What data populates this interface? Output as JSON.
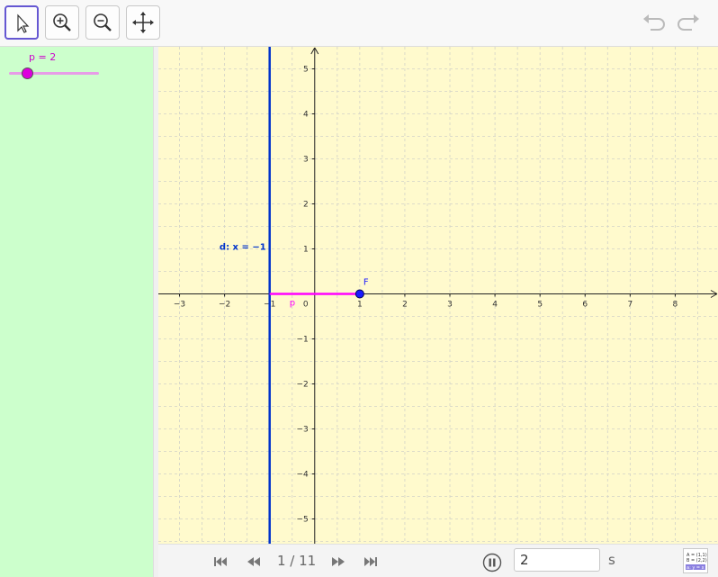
{
  "toolbar": {
    "tools": [
      {
        "icon": "arrow-pointer-icon",
        "selected": true
      },
      {
        "icon": "zoom-in-icon",
        "selected": false
      },
      {
        "icon": "zoom-out-icon",
        "selected": false
      },
      {
        "icon": "move-graphics-view-icon",
        "selected": false
      }
    ],
    "undo_icon": "undo-icon",
    "redo_icon": "redo-icon"
  },
  "slider": {
    "label": "p = 2",
    "name": "p",
    "value": 2,
    "min": 0,
    "max": 10,
    "color": "#dd00dd"
  },
  "graph": {
    "x_ticks": [
      "−3",
      "−2",
      "−1",
      "0",
      "1",
      "2",
      "3",
      "4",
      "5",
      "6",
      "7",
      "8"
    ],
    "y_ticks": [
      "5",
      "4",
      "3",
      "2",
      "1",
      "−1",
      "−2",
      "−3",
      "−4",
      "−5"
    ],
    "x_range": [
      -3.47,
      8.95
    ],
    "y_range": [
      -5.55,
      5.49
    ],
    "grid": true,
    "background": "#fffacd",
    "directrix": {
      "label": "d: x = −1",
      "x": -1,
      "color": "#0033cc"
    },
    "focus": {
      "label": "F",
      "x": 1,
      "y": 0,
      "color": "#1a1aff"
    },
    "segment": {
      "label": "p",
      "from": -1,
      "to": 1,
      "color": "#ff00ff"
    }
  },
  "playback": {
    "counter": "1 / 11",
    "speed_value": "2",
    "speed_unit": "s",
    "icons": [
      "skip-first-icon",
      "step-back-icon",
      "step-forward-icon",
      "skip-last-icon",
      "pause-icon",
      "algebra-view-icon"
    ]
  },
  "algebra_toggle": {
    "lines": [
      "A = (1,1)",
      "B = (2,2)",
      "a: y = x"
    ]
  }
}
